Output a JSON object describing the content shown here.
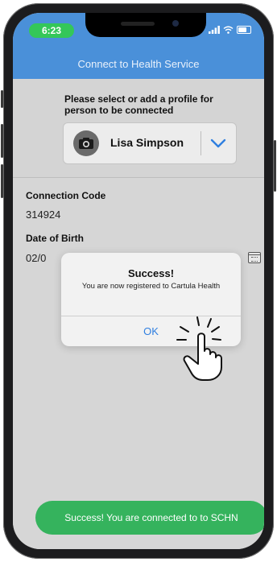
{
  "status_bar": {
    "time": "6:23",
    "signal_icon": "signal-bars-icon",
    "wifi_icon": "wifi-icon",
    "battery_icon": "battery-icon"
  },
  "nav": {
    "title": "Connect to Health Service"
  },
  "profile": {
    "prompt": "Please select or add a profile for person to be connected",
    "name": "Lisa Simpson",
    "avatar_icon": "camera-icon",
    "dropdown_icon": "chevron-down-icon"
  },
  "form": {
    "connection_code_label": "Connection Code",
    "connection_code_value": "314924",
    "dob_label": "Date of Birth",
    "dob_value": "02/0",
    "calendar_icon": "calendar-icon"
  },
  "alert": {
    "title": "Success!",
    "message": "You are now registered to Cartula Health",
    "ok_label": "OK"
  },
  "toast": {
    "message": "Success! You are connected to to SCHN"
  },
  "colors": {
    "header_blue": "#4a90d9",
    "toast_green": "#35b35d",
    "ok_blue": "#2f7fe0",
    "time_pill_green": "#34c759"
  }
}
